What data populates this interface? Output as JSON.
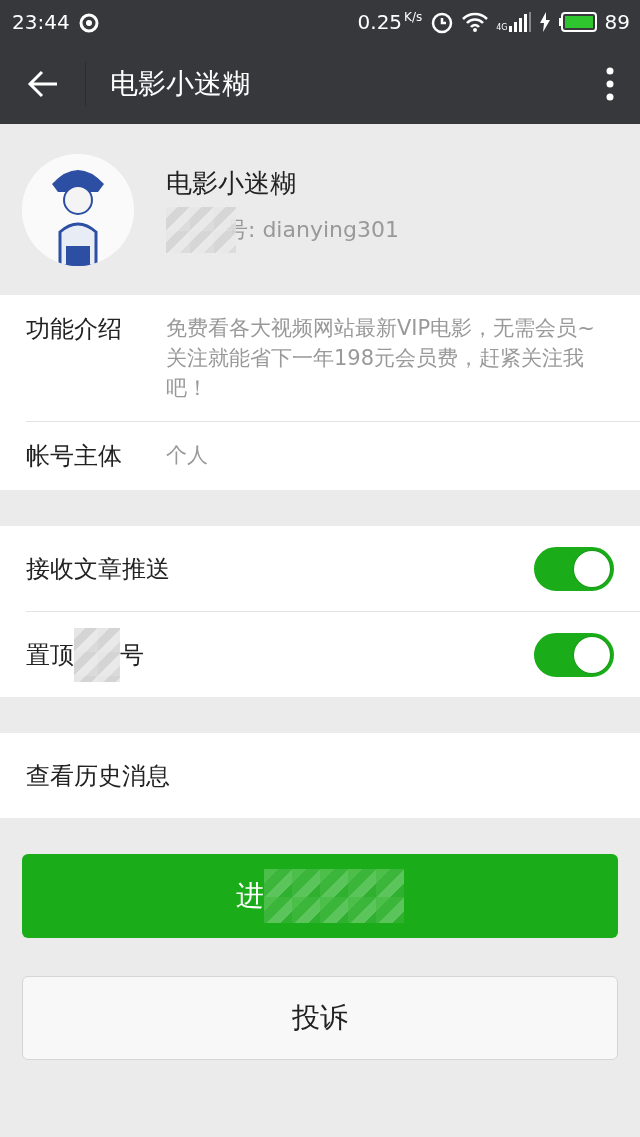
{
  "status_bar": {
    "time": "23:44",
    "speed": "0.25",
    "speed_unit": "K/s",
    "network_type": "4G",
    "battery": "89"
  },
  "toolbar": {
    "title": "电影小迷糊"
  },
  "profile": {
    "name": "电影小迷糊",
    "account_id": "号: dianying301"
  },
  "info_rows": [
    {
      "label": "功能介绍",
      "value": "免费看各大视频网站最新VIP电影，无需会员~关注就能省下一年198元会员费，赶紧关注我吧！"
    },
    {
      "label": "帐号主体",
      "value": "个人"
    }
  ],
  "toggle_rows": [
    {
      "on": true,
      "label": "接收文章推送",
      "kind": "plain"
    },
    {
      "label_parts": [
        "置顶",
        "号"
      ],
      "on": true,
      "kind": "masked"
    }
  ],
  "history": {
    "label": "查看历史消息"
  },
  "primary_button": {
    "label": "进"
  },
  "complaint_button": {
    "label": "投诉"
  }
}
